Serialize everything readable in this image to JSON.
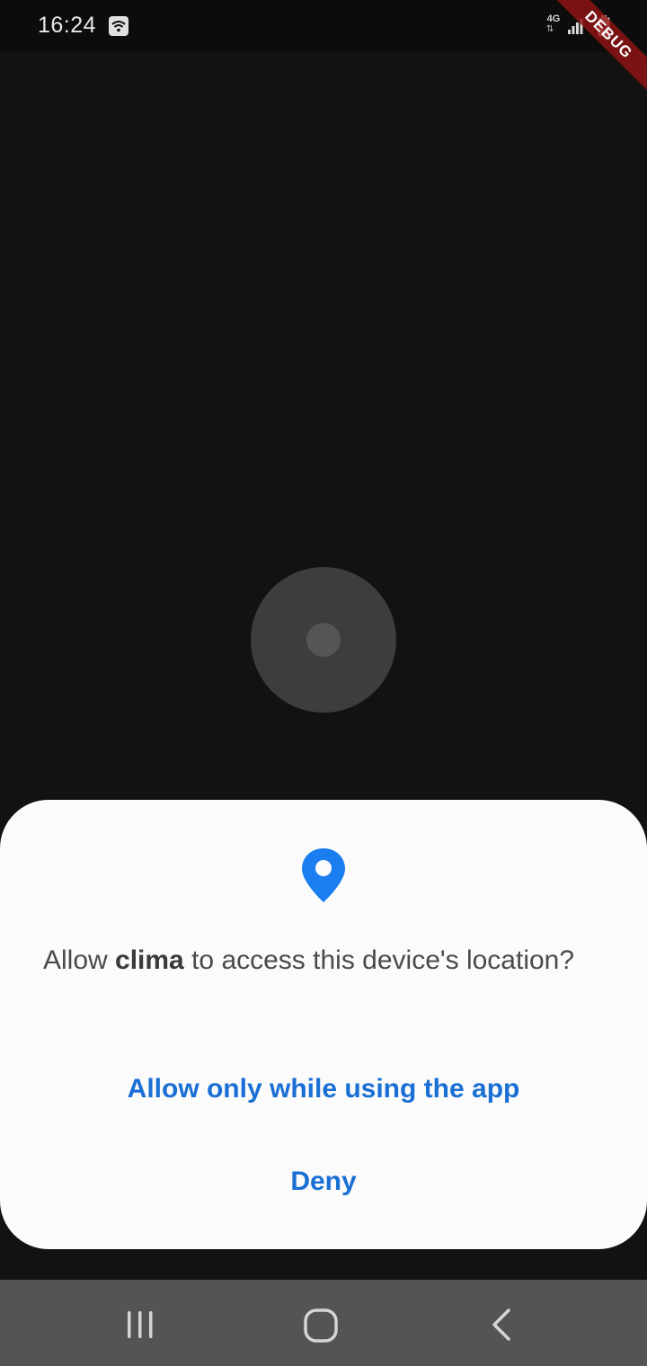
{
  "status_bar": {
    "time": "16:24",
    "network_type": "4G",
    "debug_banner": "DEBUG",
    "icons": [
      "wifi-icon",
      "signal-icon",
      "battery-charging-icon"
    ]
  },
  "loading_indicator": {
    "icon": "loading-spinner-icon"
  },
  "permission_dialog": {
    "icon": "location-pin-icon",
    "accent_color": "#1A6FD4",
    "message_prefix": "Allow ",
    "app_name": "clima",
    "message_suffix": " to access this device's location?",
    "allow_button_label": "Allow only while using the app",
    "deny_button_label": "Deny"
  },
  "navigation_bar": {
    "buttons": [
      "recents-icon",
      "home-icon",
      "back-icon"
    ]
  }
}
